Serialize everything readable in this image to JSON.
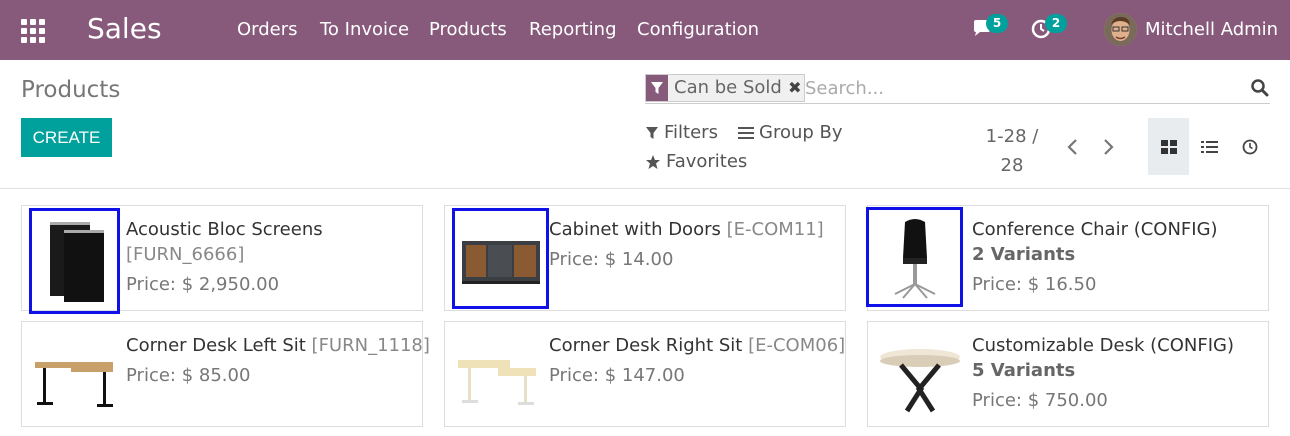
{
  "navbar": {
    "app_name": "Sales",
    "menu": [
      "Orders",
      "To Invoice",
      "Products",
      "Reporting",
      "Configuration"
    ],
    "messages_count": "5",
    "activities_count": "2",
    "user_name": "Mitchell Admin",
    "bg_color": "#875a7b",
    "badge_color": "#00a09d"
  },
  "control_panel": {
    "title": "Products",
    "create_label": "CREATE",
    "facet_label": "Can be Sold",
    "search_placeholder": "Search...",
    "filters_label": "Filters",
    "group_by_label": "Group By",
    "favorites_label": "Favorites",
    "pager_line1": "1-28 /",
    "pager_line2": "28",
    "active_view": "kanban"
  },
  "products": [
    {
      "name": "Acoustic Bloc Screens",
      "ref": "",
      "sub": "[FURN_6666]",
      "price": "Price: $ 2,950.00"
    },
    {
      "name": "Cabinet with Doors",
      "ref": "[E-COM11]",
      "sub": "",
      "price": "Price: $ 14.00"
    },
    {
      "name": "Conference Chair (CONFIG)",
      "ref": "",
      "sub": "2 Variants",
      "price": "Price: $ 16.50"
    },
    {
      "name": "Corner Desk Left Sit",
      "ref": "[FURN_1118]",
      "sub": "",
      "price": "Price: $ 85.00"
    },
    {
      "name": "Corner Desk Right Sit",
      "ref": "[E-COM06]",
      "sub": "",
      "price": "Price: $ 147.00"
    },
    {
      "name": "Customizable Desk (CONFIG)",
      "ref": "",
      "sub": "5 Variants",
      "price": "Price: $ 750.00"
    }
  ]
}
